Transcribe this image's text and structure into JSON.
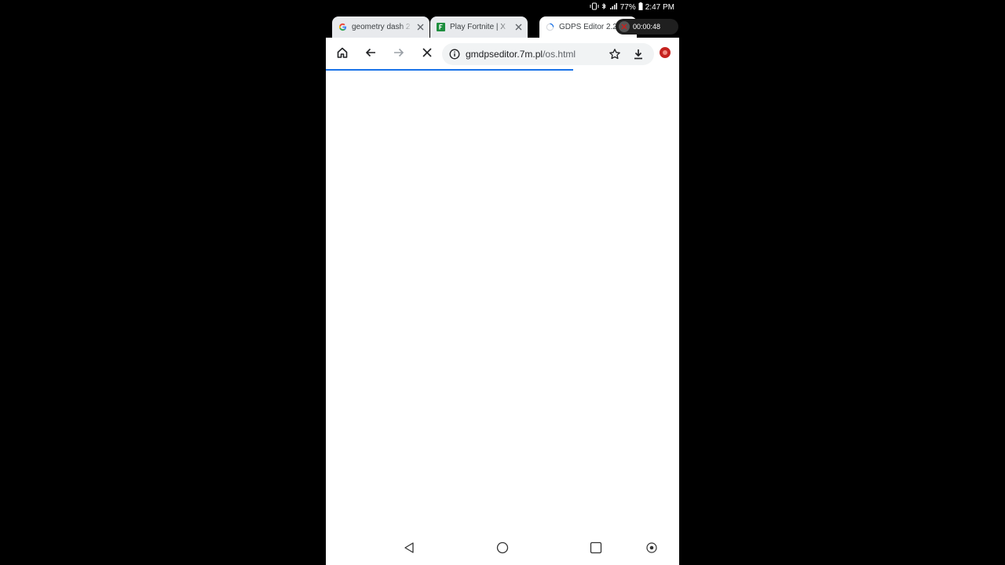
{
  "status_bar": {
    "battery": "77%",
    "time": "2:47 PM"
  },
  "tabs": [
    {
      "title": "geometry dash 2",
      "favicon": "google-icon",
      "active": false
    },
    {
      "title": "Play Fortnite | X",
      "favicon": "fortnite-icon",
      "active": false
    },
    {
      "title": "GDPS Editor 2.2",
      "favicon": "loading-spinner-icon",
      "active": true
    }
  ],
  "recorder": {
    "timer": "00:00:48"
  },
  "toolbar": {
    "url_host": "gmdpseditor.7m.pl",
    "url_path": "/os.html",
    "load_progress": 0.7
  },
  "colors": {
    "accent": "#1a73e8",
    "record": "#c5221f"
  }
}
